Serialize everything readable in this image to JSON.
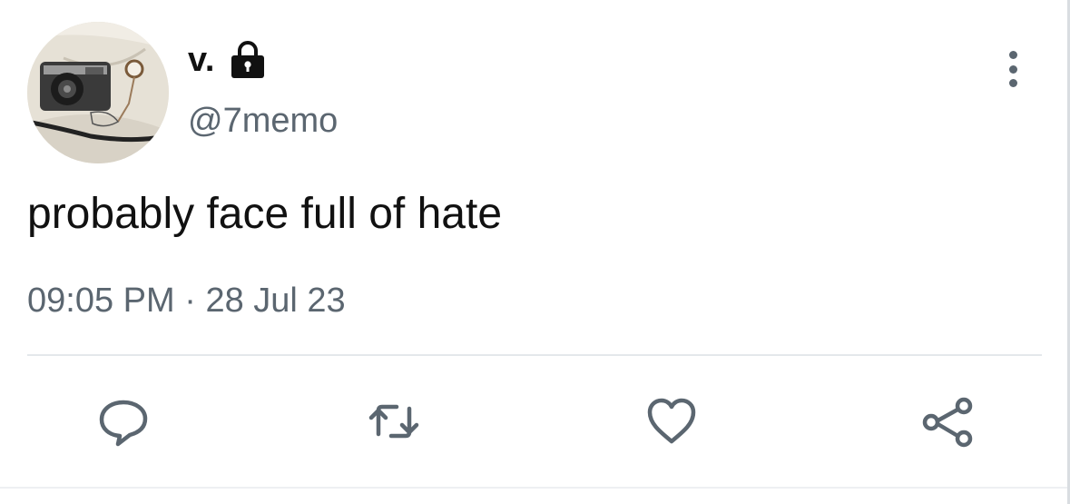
{
  "tweet": {
    "display_name": "v.",
    "handle": "@7memo",
    "text": "probably face full of hate",
    "time": "09:05 PM",
    "separator": "·",
    "date": "28 Jul 23"
  },
  "icons": {
    "protected": "lock-icon",
    "more": "vertical-ellipsis-icon",
    "reply": "speech-bubble-icon",
    "retweet": "retweet-arrows-icon",
    "like": "heart-icon",
    "share": "share-nodes-icon"
  },
  "colors": {
    "text_primary": "#111111",
    "text_secondary": "#5b6670",
    "divider": "#e4e8eb",
    "background": "#ffffff"
  }
}
